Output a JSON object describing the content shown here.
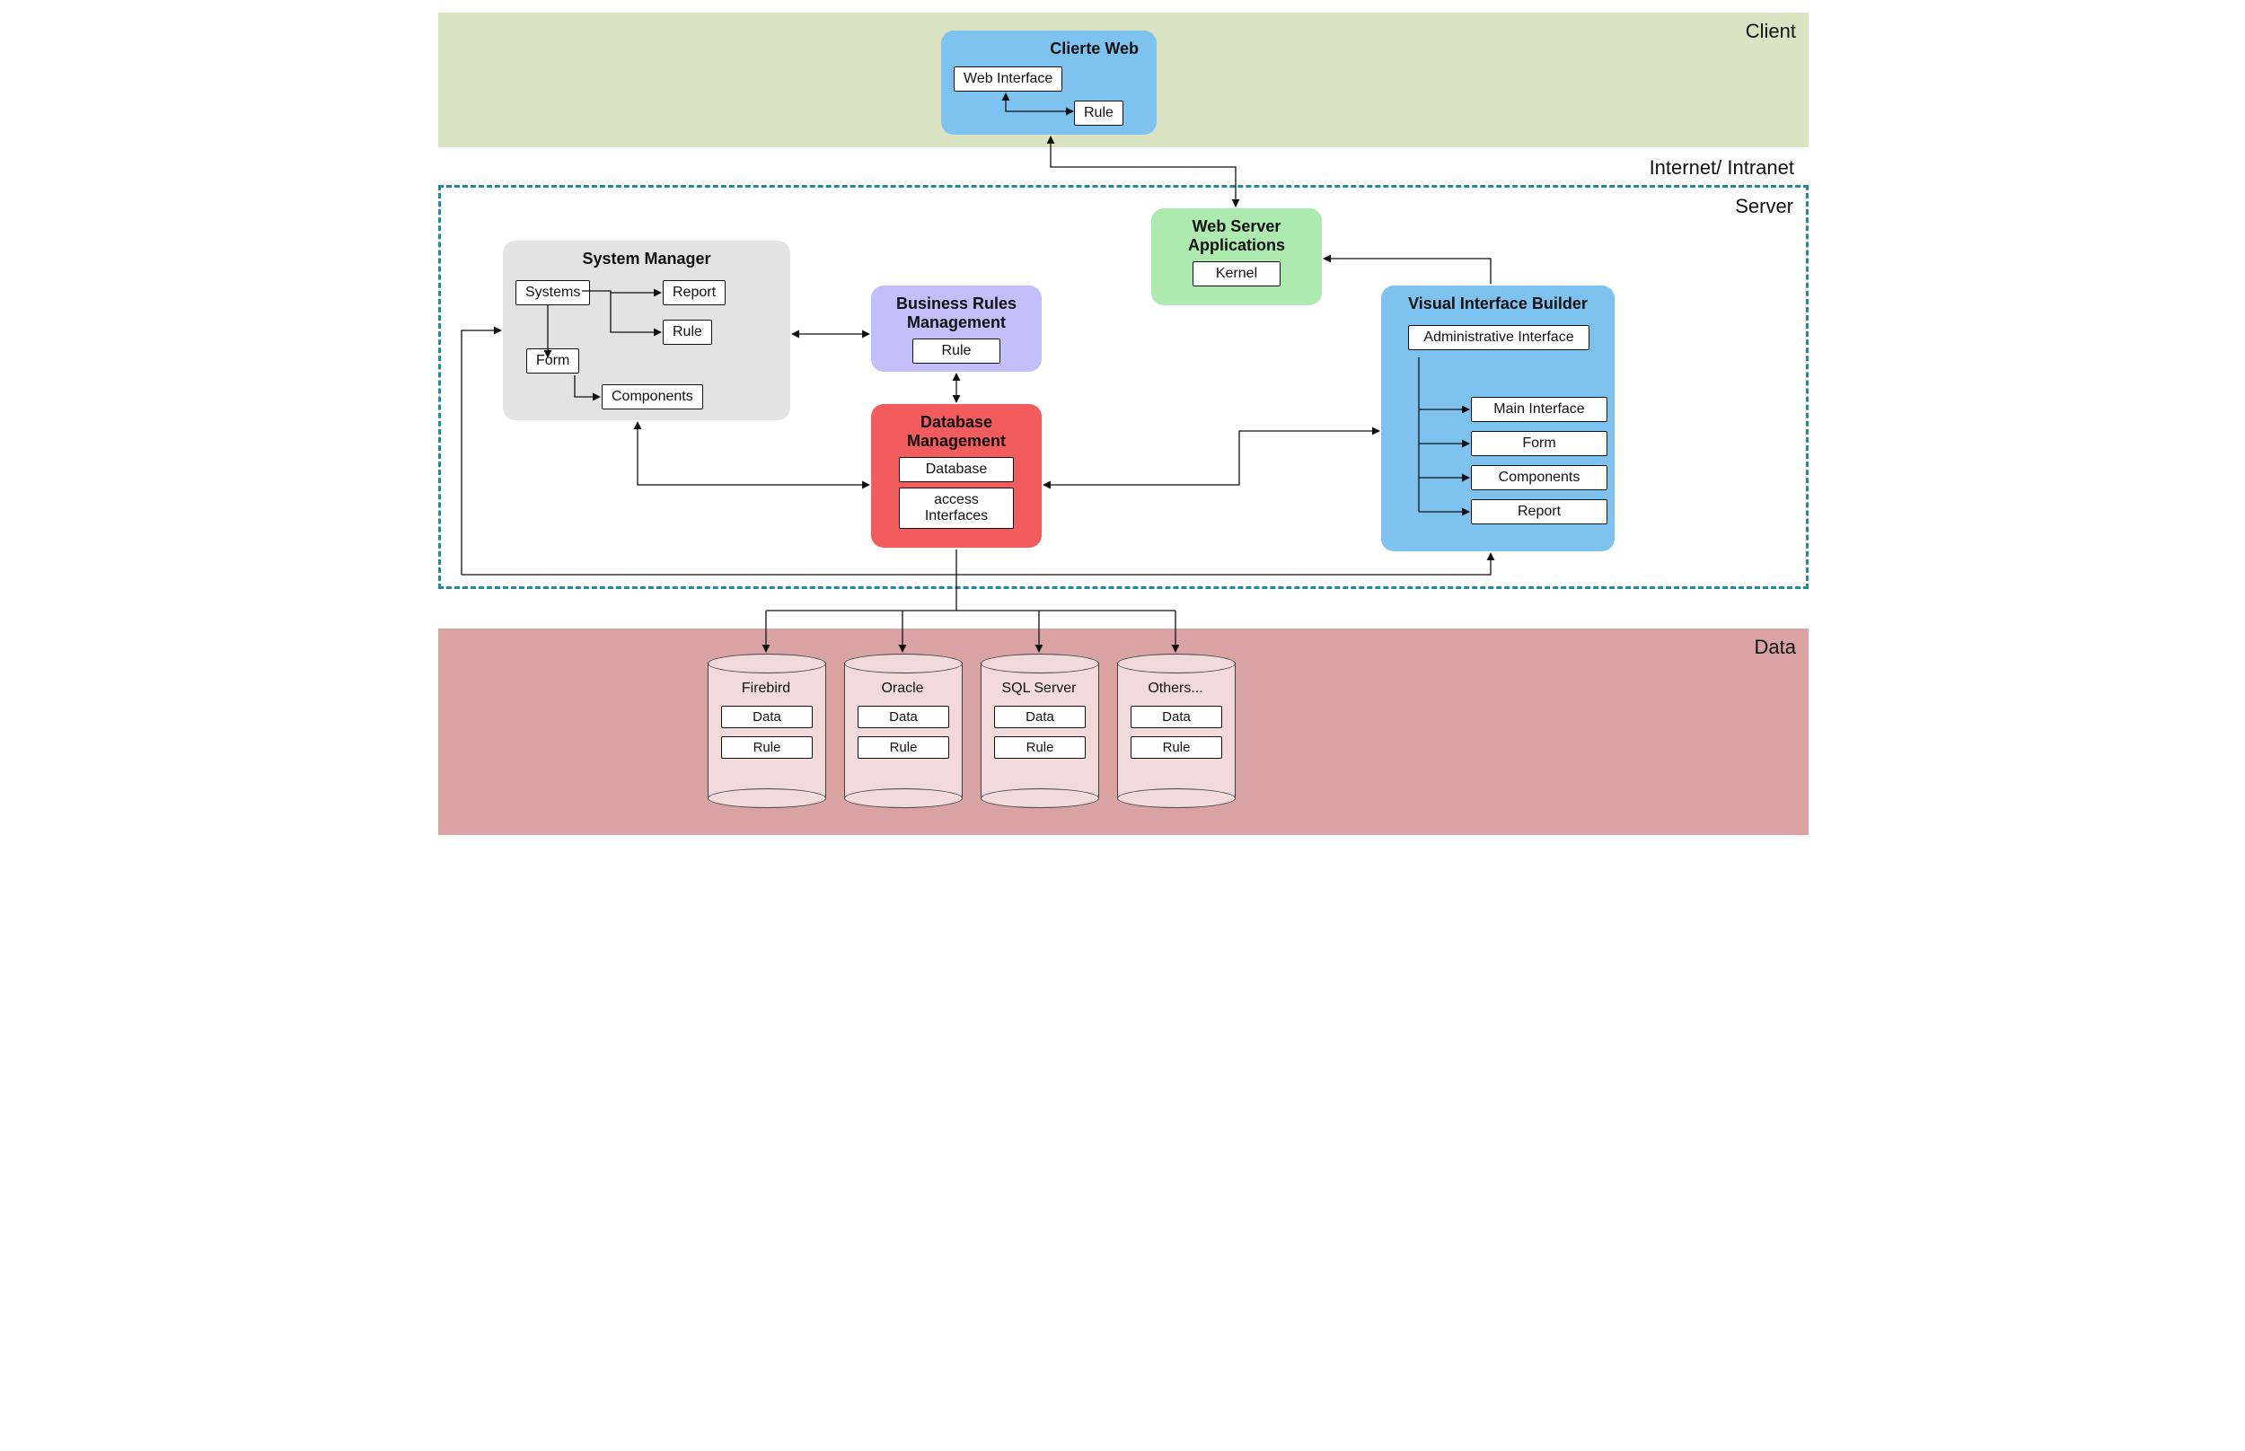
{
  "tiers": {
    "client_label": "Client",
    "between_label": "Internet/ Intranet",
    "server_label": "Server",
    "data_label": "Data"
  },
  "client_web": {
    "title": "Clierte Web",
    "web_interface": "Web Interface",
    "rule": "Rule"
  },
  "web_server_apps": {
    "title": "Web Server Applications",
    "kernel": "Kernel"
  },
  "system_manager": {
    "title": "System Manager",
    "systems": "Systems",
    "report": "Report",
    "rule": "Rule",
    "form": "Form",
    "components": "Components"
  },
  "business_rules": {
    "title": "Business Rules Management",
    "rule": "Rule"
  },
  "database_mgmt": {
    "title": "Database Management",
    "database": "Database",
    "access_interfaces": "access Interfaces"
  },
  "visual_interface_builder": {
    "title": "Visual Interface Builder",
    "admin_interface": "Administrative Interface",
    "main_interface": "Main Interface",
    "form": "Form",
    "components": "Components",
    "report": "Report"
  },
  "databases": {
    "firebird": {
      "name": "Firebird",
      "data": "Data",
      "rule": "Rule"
    },
    "oracle": {
      "name": "Oracle",
      "data": "Data",
      "rule": "Rule"
    },
    "sqlserver": {
      "name": "SQL Server",
      "data": "Data",
      "rule": "Rule"
    },
    "others": {
      "name": "Others...",
      "data": "Data",
      "rule": "Rule"
    }
  }
}
